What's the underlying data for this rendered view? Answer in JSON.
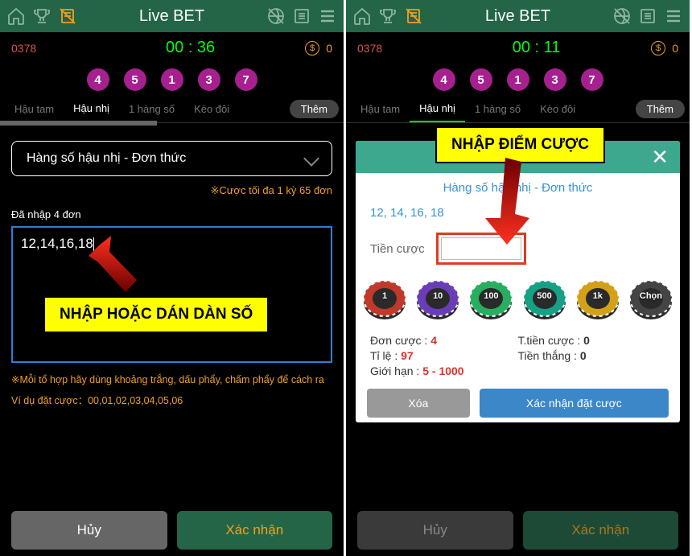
{
  "header": {
    "title": "Live BET"
  },
  "status": {
    "game_id": "0378",
    "timer_left": "00 : 36",
    "timer_right": "00 : 11",
    "coins": "0"
  },
  "balls": [
    "4",
    "5",
    "1",
    "3",
    "7"
  ],
  "tabs": {
    "t1": "Hậu tam",
    "t2": "Hậu nhị",
    "t3": "1 hàng số",
    "t4": "Kèo đôi",
    "more": "Thêm"
  },
  "dropdown": "Hàng số hậu nhị - Đơn thức",
  "max_bet": "※Cược tối đa 1 kỳ 65 đơn",
  "input_label": "Đã nhập 4 đơn",
  "input_text": "12,14,16,18",
  "hint1": "※Mỗi tổ hợp hãy dùng khoảng trắng, dấu phẩy, chấm phẩy để cách ra",
  "hint2": "Ví dụ đặt cược：00,01,02,03,04,05,06",
  "footer": {
    "cancel": "Hủy",
    "confirm": "Xác nhận"
  },
  "anno1": "NHẬP HOẶC DÁN DÀN SỐ",
  "anno2": "NHẬP ĐIỂM CƯỢC",
  "modal": {
    "title": "Hàng số hậu nhị - Đơn thức",
    "nums": "12, 14, 16, 18",
    "bet_label": "Tiền cược",
    "chips": [
      "1",
      "10",
      "100",
      "500",
      "1k",
      "Chọn"
    ],
    "s1_l": "Đơn cược :",
    "s1_v": "4",
    "s2_l": "Tỉ lệ :",
    "s2_v": "97",
    "s3_l": "Giới hạn :",
    "s3_v": "5 - 1000",
    "s4_l": "T.tiền cược :",
    "s4_v": "0",
    "s5_l": "Tiền thắng :",
    "s5_v": "0",
    "del": "Xóa",
    "ok": "Xác nhận đặt cược"
  }
}
